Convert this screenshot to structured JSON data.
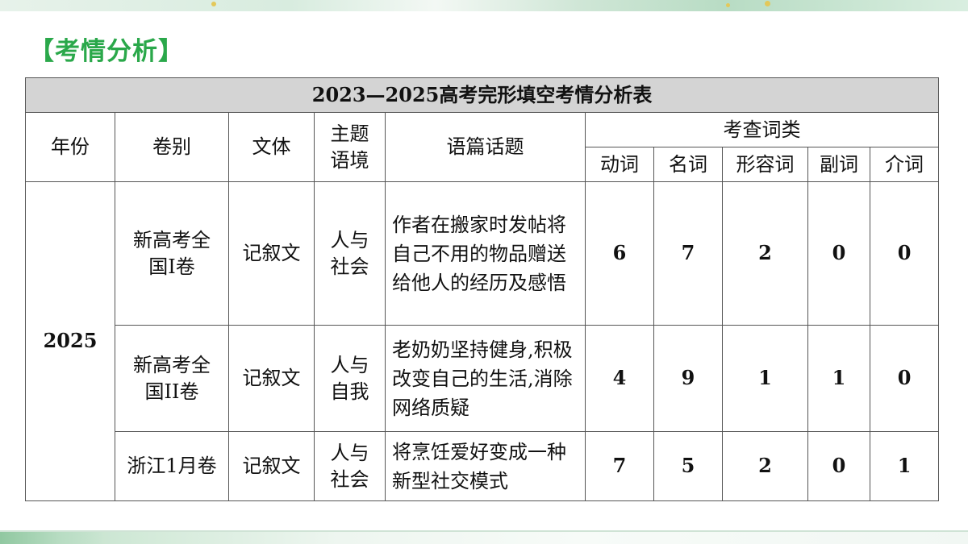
{
  "section_title": "【考情分析】",
  "table": {
    "title": "2023—2025高考完形填空考情分析表",
    "headers": {
      "year": "年份",
      "paper": "卷别",
      "genre": "文体",
      "context": "主题语境",
      "topic": "语篇话题",
      "word_types": "考查词类",
      "verb": "动词",
      "noun": "名词",
      "adjective": "形容词",
      "adverb": "副词",
      "preposition": "介词"
    },
    "year": "2025",
    "rows": [
      {
        "paper": "新高考全国I卷",
        "genre": "记叙文",
        "context": "人与社会",
        "topic": "作者在搬家时发帖将自己不用的物品赠送给他人的经历及感悟",
        "verb": "6",
        "noun": "7",
        "adjective": "2",
        "adverb": "0",
        "preposition": "0"
      },
      {
        "paper": "新高考全国II卷",
        "genre": "记叙文",
        "context": "人与自我",
        "topic": "老奶奶坚持健身,积极改变自己的生活,消除网络质疑",
        "verb": "4",
        "noun": "9",
        "adjective": "1",
        "adverb": "1",
        "preposition": "0"
      },
      {
        "paper": "浙江1月卷",
        "genre": "记叙文",
        "context": "人与社会",
        "topic": "将烹饪爱好变成一种新型社交模式",
        "verb": "7",
        "noun": "5",
        "adjective": "2",
        "adverb": "0",
        "preposition": "1"
      }
    ]
  }
}
